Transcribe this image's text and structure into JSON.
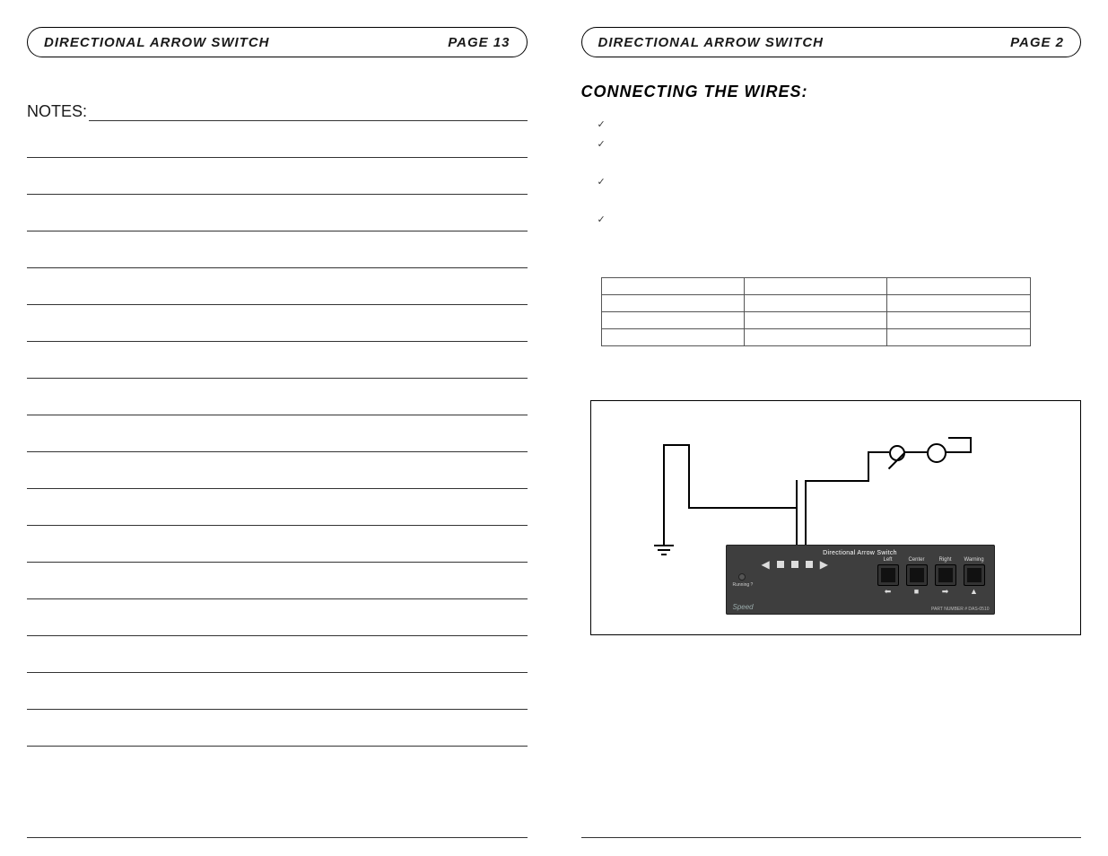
{
  "left": {
    "header_title": "DIRECTIONAL ARROW SWITCH",
    "page_label": "PAGE 13",
    "notes_label": "NOTES:"
  },
  "right": {
    "header_title": "DIRECTIONAL ARROW SWITCH",
    "page_label": "PAGE 2",
    "section_title": "CONNECTING THE WIRES:",
    "bullets": [
      "",
      "",
      "",
      ""
    ],
    "table": [
      [
        "",
        "",
        ""
      ],
      [
        "",
        "",
        ""
      ],
      [
        "",
        "",
        ""
      ],
      [
        "",
        "",
        ""
      ]
    ],
    "device": {
      "title": "Directional Arrow Switch",
      "brand": "Speed",
      "part_number": "PART NUMBER  #  DAS-0510",
      "power_label": "Running ?",
      "buttons": [
        {
          "label": "Left",
          "symbol": "⬅"
        },
        {
          "label": "Center",
          "symbol": "■"
        },
        {
          "label": "Right",
          "symbol": "➡"
        },
        {
          "label": "Warning",
          "symbol": "▲"
        }
      ]
    }
  }
}
